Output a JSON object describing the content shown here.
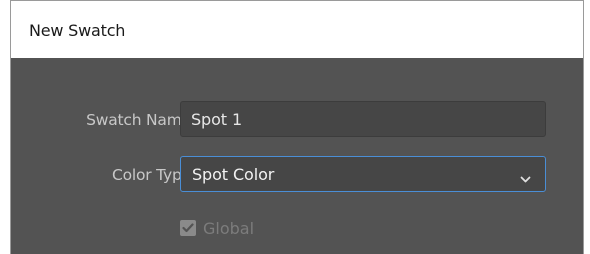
{
  "dialog": {
    "title": "New Swatch"
  },
  "fields": {
    "swatch_name_label": "Swatch Name:",
    "swatch_name_value": "Spot 1",
    "color_type_label": "Color Type:",
    "color_type_value": "Spot Color",
    "global_label": "Global",
    "global_checked": true,
    "global_enabled": false
  },
  "colors": {
    "panel_bg": "#535353",
    "field_bg": "#464646",
    "focus_border": "#4a8ed6"
  },
  "icons": {
    "dropdown": "chevron-down-icon",
    "checkbox": "checkmark-icon"
  }
}
